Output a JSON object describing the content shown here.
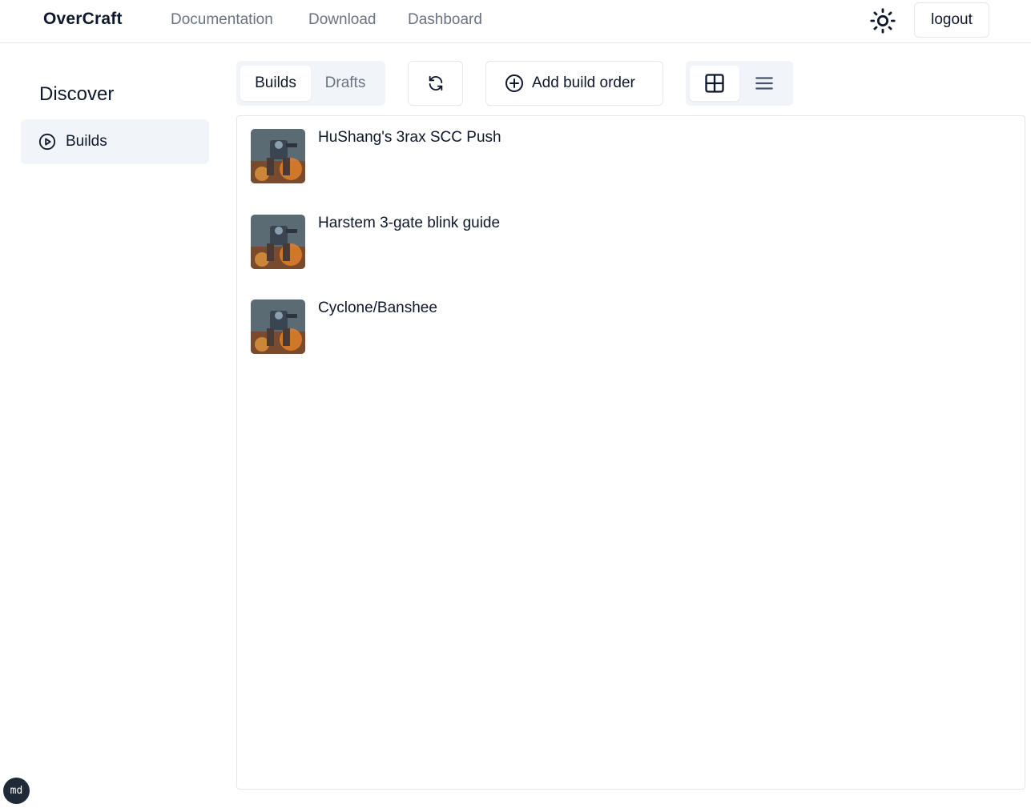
{
  "nav": {
    "brand": "OverCraft",
    "links": [
      "Documentation",
      "Download",
      "Dashboard"
    ],
    "theme_icon": "sun-icon",
    "logout_label": "logout"
  },
  "sidebar": {
    "heading": "Discover",
    "items": [
      {
        "label": "Builds",
        "icon": "play-circle-icon"
      }
    ]
  },
  "toolbar": {
    "tabs": [
      "Builds",
      "Drafts"
    ],
    "active_tab": "Builds",
    "refresh_icon": "refresh-icon",
    "add_label": "Add build order",
    "add_icon": "plus-circle-icon",
    "view_modes": [
      "grid",
      "list"
    ],
    "active_view": "grid"
  },
  "builds": [
    {
      "title": "HuShang's 3rax SCC Push"
    },
    {
      "title": "Harstem 3-gate blink guide"
    },
    {
      "title": "Cyclone/Banshee"
    }
  ],
  "badge": "md",
  "colors": {
    "muted_text": "#6b7280",
    "border": "#e5e7eb",
    "active_bg": "#f1f5f9",
    "text": "#0f172a"
  }
}
